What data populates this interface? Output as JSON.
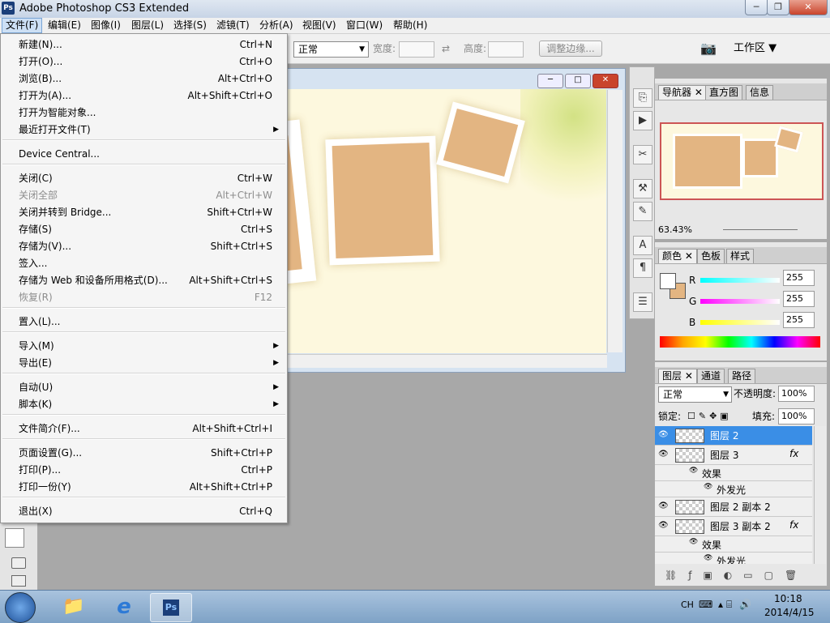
{
  "window": {
    "title": "Adobe Photoshop CS3 Extended",
    "logo": "Ps"
  },
  "menubar": [
    "文件(F)",
    "编辑(E)",
    "图像(I)",
    "图层(L)",
    "选择(S)",
    "滤镜(T)",
    "分析(A)",
    "视图(V)",
    "窗口(W)",
    "帮助(H)"
  ],
  "options": {
    "mode": "正常",
    "width_label": "宽度:",
    "height_label": "高度:",
    "refine_button": "调整边缘...",
    "workspace": "工作区"
  },
  "file_menu": [
    {
      "label": "新建(N)...",
      "shortcut": "Ctrl+N"
    },
    {
      "label": "打开(O)...",
      "shortcut": "Ctrl+O"
    },
    {
      "label": "浏览(B)...",
      "shortcut": "Alt+Ctrl+O"
    },
    {
      "label": "打开为(A)...",
      "shortcut": "Alt+Shift+Ctrl+O"
    },
    {
      "label": "打开为智能对象...",
      "shortcut": ""
    },
    {
      "label": "最近打开文件(T)",
      "shortcut": "",
      "submenu": true
    },
    {
      "label": "Device Central...",
      "shortcut": ""
    },
    {
      "label": "关闭(C)",
      "shortcut": "Ctrl+W"
    },
    {
      "label": "关闭全部",
      "shortcut": "Alt+Ctrl+W",
      "disabled": true
    },
    {
      "label": "关闭并转到 Bridge...",
      "shortcut": "Shift+Ctrl+W"
    },
    {
      "label": "存储(S)",
      "shortcut": "Ctrl+S"
    },
    {
      "label": "存储为(V)...",
      "shortcut": "Shift+Ctrl+S"
    },
    {
      "label": "签入...",
      "shortcut": ""
    },
    {
      "label": "存储为 Web 和设备所用格式(D)...",
      "shortcut": "Alt+Shift+Ctrl+S"
    },
    {
      "label": "恢复(R)",
      "shortcut": "F12",
      "disabled": true
    },
    {
      "label": "置入(L)...",
      "shortcut": ""
    },
    {
      "label": "导入(M)",
      "shortcut": "",
      "submenu": true
    },
    {
      "label": "导出(E)",
      "shortcut": "",
      "submenu": true
    },
    {
      "label": "自动(U)",
      "shortcut": "",
      "submenu": true
    },
    {
      "label": "脚本(K)",
      "shortcut": "",
      "submenu": true
    },
    {
      "label": "文件简介(F)...",
      "shortcut": "Alt+Shift+Ctrl+I"
    },
    {
      "label": "页面设置(G)...",
      "shortcut": "Shift+Ctrl+P"
    },
    {
      "label": "打印(P)...",
      "shortcut": "Ctrl+P"
    },
    {
      "label": "打印一份(Y)",
      "shortcut": "Alt+Shift+Ctrl+P"
    },
    {
      "label": "退出(X)",
      "shortcut": "Ctrl+Q"
    }
  ],
  "navigator": {
    "tabs": [
      "导航器",
      "直方图",
      "信息"
    ],
    "zoom": "63.43%"
  },
  "color": {
    "tabs": [
      "颜色",
      "色板",
      "样式"
    ],
    "r_label": "R",
    "g_label": "G",
    "b_label": "B",
    "r": "255",
    "g": "255",
    "b": "255"
  },
  "layers": {
    "tabs": [
      "图层",
      "通道",
      "路径"
    ],
    "blend": "正常",
    "opacity_label": "不透明度:",
    "opacity": "100%",
    "lock_label": "锁定:",
    "fill_label": "填充:",
    "fill": "100%",
    "fx": "fx",
    "rows": [
      {
        "name": "图层 2",
        "selected": true
      },
      {
        "name": "图层 3",
        "fx": true
      },
      {
        "effect": "效果"
      },
      {
        "subeffect": "外发光"
      },
      {
        "name": "图层 2 副本 2"
      },
      {
        "name": "图层 3 副本 2",
        "fx": true
      },
      {
        "effect": "效果"
      },
      {
        "subeffect": "外发光"
      }
    ]
  },
  "taskbar": {
    "ime": "CH",
    "time": "10:18",
    "date": "2014/4/15"
  }
}
